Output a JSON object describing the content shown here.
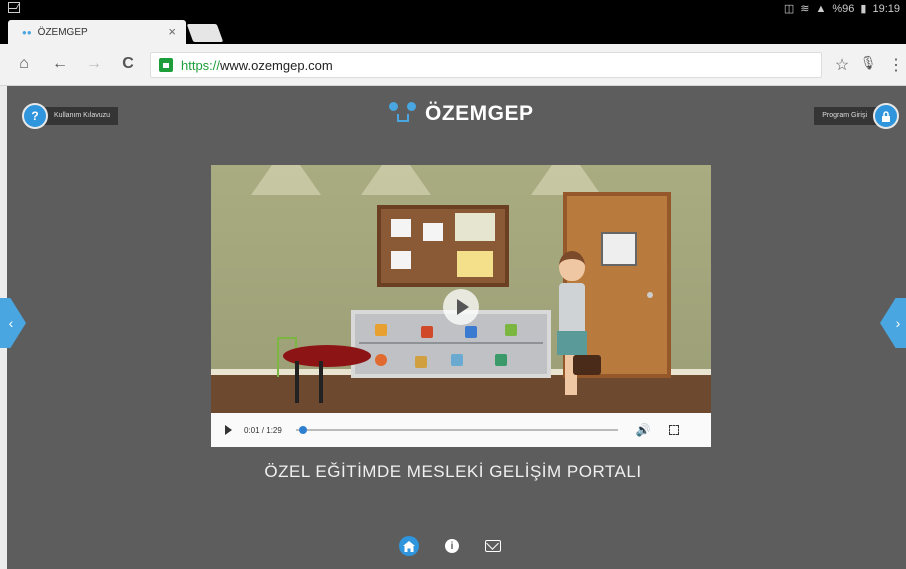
{
  "status_bar": {
    "time": "19:19",
    "battery": "%96",
    "icons": [
      "gallery-icon",
      "mute-icon",
      "wifi-icon",
      "signal-icon",
      "battery-icon"
    ]
  },
  "browser": {
    "tab": {
      "title": "ÖZEMGEP",
      "favicon": "ozemgep-favicon",
      "close": "×"
    },
    "address": {
      "scheme": "https://",
      "host": "www.ozemgep.com"
    },
    "toolbar_icons": {
      "home": "⌂",
      "back": "←",
      "forward": "→",
      "reload": "C",
      "bookmark": "☆",
      "mic": "🎙",
      "menu": "⋮"
    }
  },
  "page": {
    "help_button": {
      "icon": "?",
      "label": "Kullanım Kılavuzu"
    },
    "login_button": {
      "icon": "🔒",
      "label": "Program Girişi"
    },
    "logo": {
      "text": "ÖZEMGEP"
    },
    "prev_arrow": "‹",
    "next_arrow": "›",
    "video": {
      "current_time": "0:01",
      "duration": "1:29",
      "time_display": "0:01 / 1:29",
      "progress": 0.01
    },
    "portal_title": "ÖZEL EĞİTİMDE MESLEKİ GELİŞİM PORTALI",
    "bottom_nav": [
      {
        "name": "home-icon",
        "active": true
      },
      {
        "name": "info-icon",
        "active": false
      },
      {
        "name": "mail-icon",
        "active": false
      }
    ],
    "colors": {
      "accent": "#2f95dc",
      "background": "#5d5d5d"
    }
  }
}
